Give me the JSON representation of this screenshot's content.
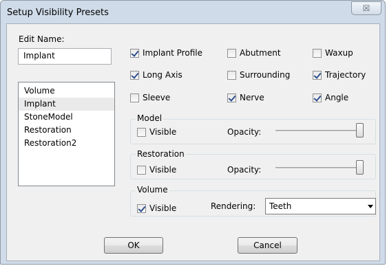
{
  "window": {
    "title": "Setup Visibility Presets",
    "close_glyph": "☒"
  },
  "edit_name": {
    "label": "Edit Name:",
    "value": "Implant"
  },
  "presets": {
    "items": [
      "Volume",
      "Implant",
      "StoneModel",
      "Restoration",
      "Restoration2"
    ],
    "selected": "Implant"
  },
  "checkboxes": {
    "implant_profile": {
      "label": "Implant Profile",
      "checked": true
    },
    "abutment": {
      "label": "Abutment",
      "checked": false
    },
    "waxup": {
      "label": "Waxup",
      "checked": false
    },
    "long_axis": {
      "label": "Long Axis",
      "checked": true
    },
    "surrounding": {
      "label": "Surrounding",
      "checked": false
    },
    "trajectory": {
      "label": "Trajectory",
      "checked": true
    },
    "sleeve": {
      "label": "Sleeve",
      "checked": false
    },
    "nerve": {
      "label": "Nerve",
      "checked": true
    },
    "angle": {
      "label": "Angle",
      "checked": true
    }
  },
  "model_group": {
    "title": "Model",
    "visible_label": "Visible",
    "visible_checked": false,
    "opacity_label": "Opacity:",
    "opacity_value": 1.0
  },
  "restoration_group": {
    "title": "Restoration",
    "visible_label": "Visible",
    "visible_checked": false,
    "opacity_label": "Opacity:",
    "opacity_value": 1.0
  },
  "volume_group": {
    "title": "Volume",
    "visible_label": "Visible",
    "visible_checked": true,
    "rendering_label": "Rendering:",
    "rendering_value": "Teeth"
  },
  "buttons": {
    "ok": "OK",
    "cancel": "Cancel"
  }
}
